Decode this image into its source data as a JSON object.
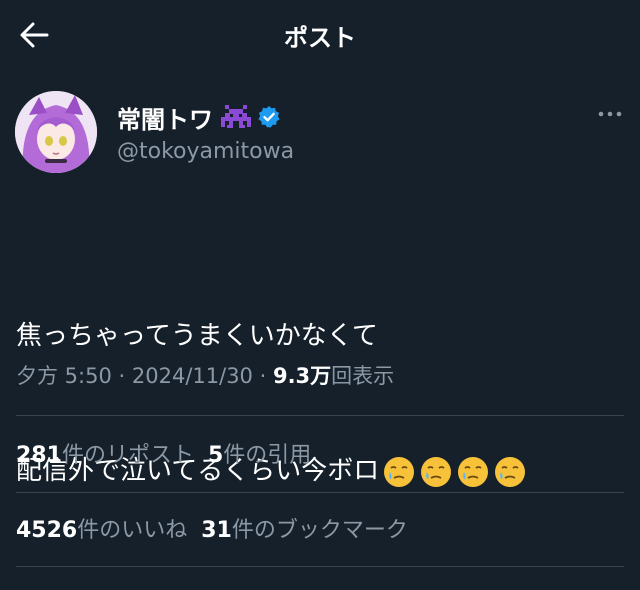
{
  "header": {
    "title": "ポスト",
    "back_icon": "arrow-left-icon"
  },
  "author": {
    "name": "常闇トワ",
    "handle": "@tokoyamitowa",
    "name_emoji": "purple-alien-monster-icon",
    "badge": "verified-badge-icon",
    "badge_color": "#1d9bf0"
  },
  "post": {
    "lines": [
      "焦っちゃってうまくいかなくて",
      "配信外で泣いてるくらい今ボロ"
    ],
    "trailing_emoji": "face-holding-back-tears-icon",
    "trailing_emoji_count": 4
  },
  "meta": {
    "time": "夕方 5:50",
    "sep": " · ",
    "date": "2024/11/30",
    "views_value": "9.3",
    "views_unit": "万",
    "views_suffix": "回表示"
  },
  "stats_row1": [
    {
      "num": "281",
      "label": "件のリポスト"
    },
    {
      "num": "5",
      "label": "件の引用"
    }
  ],
  "stats_row2": [
    {
      "num": "4526",
      "label": "件のいいね"
    },
    {
      "num": "31",
      "label": "件のブックマーク"
    }
  ],
  "colors": {
    "background": "#15202b",
    "text": "#e7e9ea",
    "secondary": "#8b98a5",
    "divider": "#38444d",
    "accent": "#1d9bf0"
  }
}
